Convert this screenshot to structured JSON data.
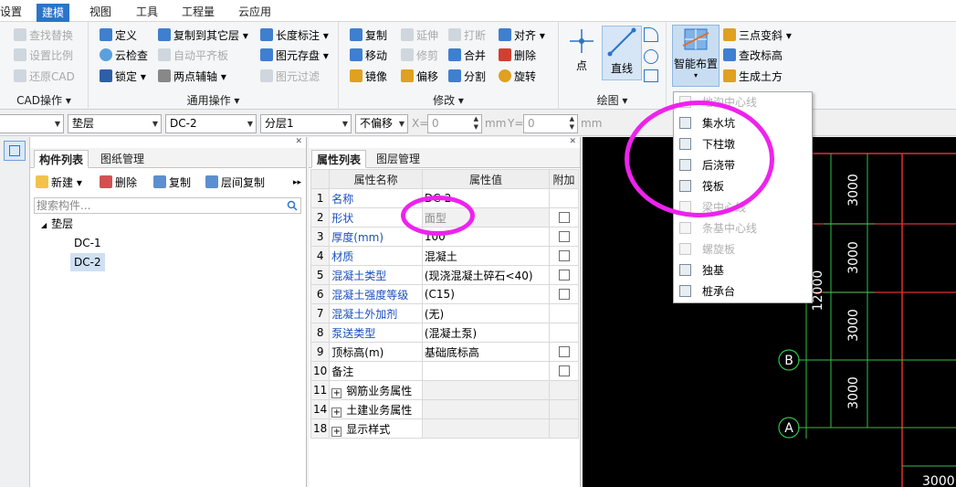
{
  "menubar": {
    "tabs": [
      "设置",
      "建模",
      "视图",
      "工具",
      "工程量",
      "云应用"
    ],
    "active": "建模"
  },
  "ribbon": {
    "cad": {
      "items": [
        "查找替换",
        "设置比例",
        "还原CAD"
      ],
      "group": "CAD操作"
    },
    "general": {
      "define": "定义",
      "cloudcheck": "云检查",
      "lock": "锁定",
      "copy_to_layer": "复制到其它层",
      "auto_align": "自动平齐板",
      "two_point_axis": "两点辅轴",
      "length_dim": "长度标注",
      "elem_save": "图元存盘",
      "elem_filter": "图元过滤",
      "group": "通用操作"
    },
    "modify": {
      "copy": "复制",
      "extend": "延伸",
      "break": "打断",
      "align": "对齐",
      "move": "移动",
      "trim": "修剪",
      "merge": "合并",
      "delete": "删除",
      "mirror": "镜像",
      "offset": "偏移",
      "split": "分割",
      "rotate": "旋转",
      "group": "修改"
    },
    "draw": {
      "point": "点",
      "line": "直线",
      "group": "绘图"
    },
    "smart": {
      "smart_layout": "智能布置",
      "three_point_slope": "三点变斜",
      "check_elevation": "查改标高",
      "gen_earthwork": "生成土方"
    }
  },
  "toolbar2": {
    "floor": "",
    "component_type": "垫层",
    "component": "DC-2",
    "sublayer": "分层1",
    "offset": "不偏移",
    "x_label": "X=",
    "x_value": "0",
    "x_unit": "mm",
    "y_label": "Y=",
    "y_value": "0",
    "y_unit": "mm"
  },
  "component_panel": {
    "tab_list": "构件列表",
    "tab_drawings": "图纸管理",
    "new": "新建",
    "delete": "删除",
    "copy": "复制",
    "floor_copy": "层间复制",
    "search_placeholder": "搜索构件...",
    "root": "垫层",
    "items": [
      "DC-1",
      "DC-2"
    ]
  },
  "property_panel": {
    "tab_props": "属性列表",
    "tab_layers": "图层管理",
    "headers": [
      "属性名称",
      "属性值",
      "附加"
    ],
    "rows": [
      {
        "num": "1",
        "name": "名称",
        "value": "DC-2"
      },
      {
        "num": "2",
        "name": "形状",
        "value": "面型"
      },
      {
        "num": "3",
        "name": "厚度(mm)",
        "value": "100"
      },
      {
        "num": "4",
        "name": "材质",
        "value": "混凝土"
      },
      {
        "num": "5",
        "name": "混凝土类型",
        "value": "(现浇混凝土碎石<40)"
      },
      {
        "num": "6",
        "name": "混凝土强度等级",
        "value": "(C15)"
      },
      {
        "num": "7",
        "name": "混凝土外加剂",
        "value": "(无)"
      },
      {
        "num": "8",
        "name": "泵送类型",
        "value": "(混凝土泵)"
      },
      {
        "num": "9",
        "name": "顶标高(m)",
        "value": "基础底标高"
      },
      {
        "num": "10",
        "name": "备注",
        "value": ""
      },
      {
        "num": "11",
        "name": "钢筋业务属性",
        "value": ""
      },
      {
        "num": "14",
        "name": "土建业务属性",
        "value": ""
      },
      {
        "num": "18",
        "name": "显示样式",
        "value": ""
      }
    ]
  },
  "dropdown": {
    "items": [
      "地沟中心线",
      "集水坑",
      "下柱墩",
      "后浇带",
      "筏板",
      "梁中心线",
      "条基中心线",
      "螺旋板",
      "独基",
      "桩承台"
    ]
  },
  "canvas": {
    "dims": [
      "3000",
      "3000",
      "3000",
      "3000",
      "12000",
      "3000"
    ],
    "axes": [
      "B",
      "A"
    ]
  },
  "colors": {
    "accent": "#2b74c7",
    "annotation": "#ee22ee",
    "canvas": "#000000"
  }
}
